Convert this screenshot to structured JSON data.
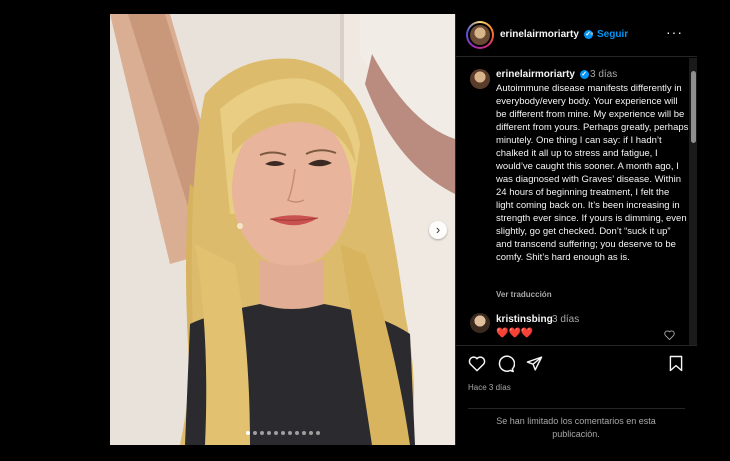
{
  "post": {
    "username": "erinelairmoriarty",
    "follow_label": "Seguir",
    "separator": "•",
    "more_label": "···",
    "caption_time": "3 días",
    "caption": "Autoimmune disease manifests differently in everybody/every body. Your experience will be different from mine. My experience will be different from yours. Perhaps greatly, perhaps minutely. One thing I can say: if I hadn’t chalked it all up to stress and fatigue, I would’ve caught this sooner. A month ago, I was diagnosed with Graves’ disease. Within 24 hours of beginning treatment, I felt the light coming back on. It’s been increasing in strength ever since. If yours is dimming, even slightly, go get checked. Don’t “suck it up” and transcend suffering; you deserve to be comfy. Shit’s hard enough as is.",
    "translate_label": "Ver traducción",
    "posted_ago": "Hace 3 días",
    "comments_limited": "Se han limitado los comentarios en esta publicación.",
    "carousel": {
      "slide_count": 11,
      "active_index": 0
    }
  },
  "comment": {
    "username": "kristinsbing",
    "time": "3 días",
    "text": "❤️❤️❤️"
  },
  "icons": {
    "verified": "verified-badge-icon",
    "next": "chevron-right-icon",
    "like": "heart-icon",
    "comment": "comment-icon",
    "share": "paper-plane-icon",
    "save": "bookmark-icon"
  },
  "colors": {
    "accent": "#0095f6",
    "background": "#000000",
    "heart": "#ed4956"
  }
}
